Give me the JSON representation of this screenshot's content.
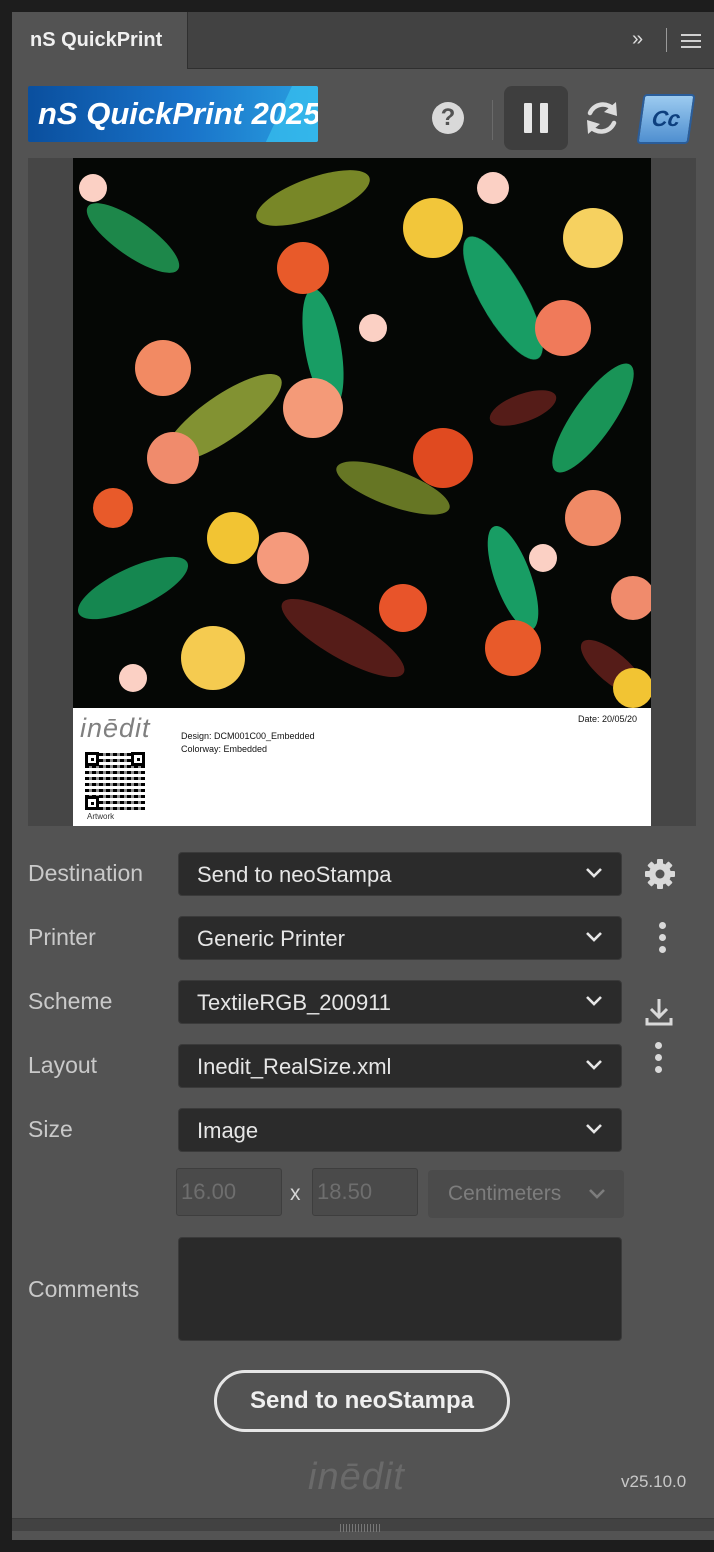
{
  "panel": {
    "tab_title": "nS QuickPrint",
    "expand_glyph": "»",
    "menu_icon": "hamburger-icon"
  },
  "header": {
    "logo_text": "nS QuickPrint 2025",
    "help_glyph": "?",
    "icons": [
      "help-icon",
      "pause-icon",
      "refresh-icon",
      "creative-cloud-icon"
    ],
    "cc_text": "Cc"
  },
  "preview": {
    "brand": "inēdit",
    "design_line": "Design: DCM001C00_Embedded",
    "colorway_line": "Colorway: Embedded",
    "date_line": "Date: 20/05/20",
    "qr_caption": "Artwork"
  },
  "form": {
    "destination": {
      "label": "Destination",
      "value": "Send to neoStampa"
    },
    "printer": {
      "label": "Printer",
      "value": "Generic Printer"
    },
    "scheme": {
      "label": "Scheme",
      "value": "TextileRGB_200911"
    },
    "layout": {
      "label": "Layout",
      "value": "Inedit_RealSize.xml"
    },
    "size": {
      "label": "Size",
      "value": "Image",
      "width": "16.00",
      "height": "18.50",
      "times": "x",
      "units": "Centimeters"
    },
    "comments": {
      "label": "Comments",
      "value": ""
    }
  },
  "actions": {
    "send_label": "Send to neoStampa"
  },
  "footer": {
    "brand": "inēdit",
    "version": "v25.10.0"
  },
  "colors": {
    "panel_bg": "#535353",
    "field_bg": "#2b2b2b",
    "logo_blue": "#1973c9",
    "text": "#e6e6e6"
  }
}
